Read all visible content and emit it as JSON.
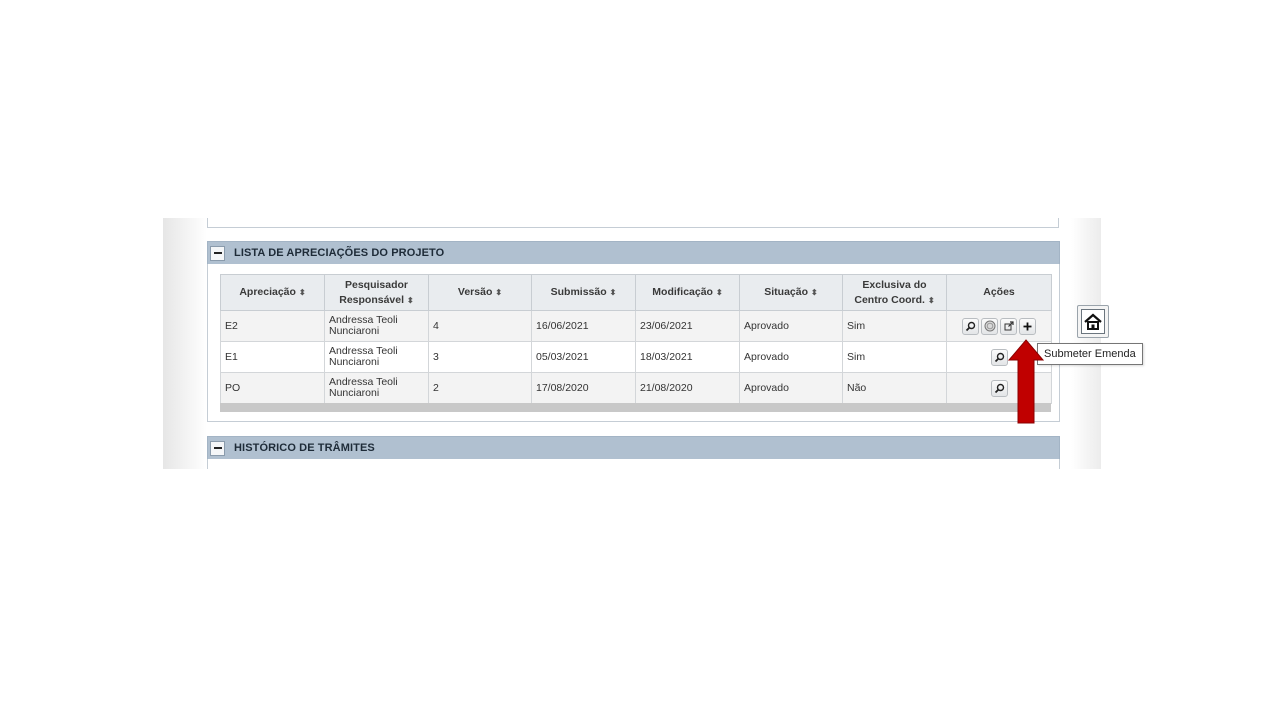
{
  "panel_list": {
    "title": "LISTA DE APRECIAÇÕES DO PROJETO",
    "columns": [
      {
        "label_line1": "Apreciação",
        "label_line2": "",
        "sortable": true
      },
      {
        "label_line1": "Pesquisador",
        "label_line2": "Responsável",
        "sortable": true
      },
      {
        "label_line1": "Versão",
        "label_line2": "",
        "sortable": true
      },
      {
        "label_line1": "Submissão",
        "label_line2": "",
        "sortable": true
      },
      {
        "label_line1": "Modificação",
        "label_line2": "",
        "sortable": true
      },
      {
        "label_line1": "Situação",
        "label_line2": "",
        "sortable": true
      },
      {
        "label_line1": "Exclusiva do",
        "label_line2": "Centro Coord.",
        "sortable": true
      },
      {
        "label_line1": "Ações",
        "label_line2": "",
        "sortable": false
      }
    ],
    "rows": [
      {
        "apreciacao": "E2",
        "pesquisador_l1": "Andressa Teoli",
        "pesquisador_l2": "Nunciaroni",
        "versao": "4",
        "submissao": "16/06/2021",
        "modificacao": "23/06/2021",
        "situacao": "Aprovado",
        "exclusiva": "Sim",
        "actions": [
          "search-icon",
          "history-icon",
          "external-link-icon",
          "plus-icon"
        ]
      },
      {
        "apreciacao": "E1",
        "pesquisador_l1": "Andressa Teoli",
        "pesquisador_l2": "Nunciaroni",
        "versao": "3",
        "submissao": "05/03/2021",
        "modificacao": "18/03/2021",
        "situacao": "Aprovado",
        "exclusiva": "Sim",
        "actions": [
          "search-icon"
        ]
      },
      {
        "apreciacao": "PO",
        "pesquisador_l1": "Andressa Teoli",
        "pesquisador_l2": "Nunciaroni",
        "versao": "2",
        "submissao": "17/08/2020",
        "modificacao": "21/08/2020",
        "situacao": "Aprovado",
        "exclusiva": "Não",
        "actions": [
          "search-icon"
        ]
      }
    ]
  },
  "panel_history": {
    "title": "HISTÓRICO DE TRÂMITES"
  },
  "sort_glyph": "⬍",
  "tooltip": {
    "text": "Submeter Emenda"
  },
  "side_button": {
    "icon": "home-icon"
  },
  "annotation": {
    "icon": "arrow-up-icon",
    "color": "#c00000"
  },
  "colors": {
    "panel_header_bg": "#b0c0d0",
    "table_header_bg": "#e9ecef",
    "alt_row_bg": "#f3f3f3"
  }
}
